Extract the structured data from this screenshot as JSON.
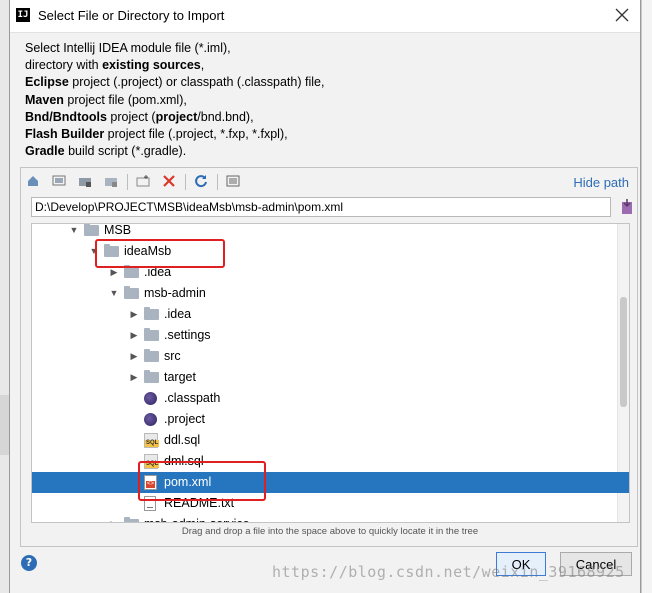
{
  "window": {
    "title": "Select File or Directory to Import",
    "app_icon_label": "IJ"
  },
  "description": {
    "lines": [
      [
        {
          "t": "Select Intellij IDEA module file (*.iml),",
          "b": false
        }
      ],
      [
        {
          "t": "directory with ",
          "b": false
        },
        {
          "t": "existing sources",
          "b": true
        },
        {
          "t": ",",
          "b": false
        }
      ],
      [
        {
          "t": "Eclipse",
          "b": true
        },
        {
          "t": " project (.project) or classpath (.classpath) file,",
          "b": false
        }
      ],
      [
        {
          "t": "Maven",
          "b": true
        },
        {
          "t": " project file (pom.xml),",
          "b": false
        }
      ],
      [
        {
          "t": "Bnd/Bndtools",
          "b": true
        },
        {
          "t": " project (",
          "b": false
        },
        {
          "t": "project",
          "b": true
        },
        {
          "t": "/bnd.bnd),",
          "b": false
        }
      ],
      [
        {
          "t": "Flash Builder",
          "b": true
        },
        {
          "t": " project file (.project, *.fxp, *.fxpl),",
          "b": false
        }
      ],
      [
        {
          "t": "Gradle",
          "b": true
        },
        {
          "t": " build script (*.gradle).",
          "b": false
        }
      ]
    ]
  },
  "toolbar": {
    "hide_path_label": "Hide path"
  },
  "path": {
    "value": "D:\\Develop\\PROJECT\\MSB\\ideaMsb\\msb-admin\\pom.xml"
  },
  "tree": {
    "rows": [
      {
        "label": "MSB",
        "arrow": "down",
        "icon": "folder",
        "level": 0
      },
      {
        "label": "ideaMsb",
        "arrow": "down",
        "icon": "folder",
        "level": 1
      },
      {
        "label": ".idea",
        "arrow": "right",
        "icon": "folder",
        "level": 2
      },
      {
        "label": "msb-admin",
        "arrow": "down",
        "icon": "folder",
        "level": 2
      },
      {
        "label": ".idea",
        "arrow": "right",
        "icon": "folder",
        "level": 3
      },
      {
        "label": ".settings",
        "arrow": "right",
        "icon": "folder",
        "level": 3
      },
      {
        "label": "src",
        "arrow": "right",
        "icon": "folder",
        "level": 3
      },
      {
        "label": "target",
        "arrow": "right",
        "icon": "folder",
        "level": 3
      },
      {
        "label": ".classpath",
        "arrow": "",
        "icon": "eclipse",
        "level": 3
      },
      {
        "label": ".project",
        "arrow": "",
        "icon": "eclipse",
        "level": 3
      },
      {
        "label": "ddl.sql",
        "arrow": "",
        "icon": "sql",
        "level": 3
      },
      {
        "label": "dml.sql",
        "arrow": "",
        "icon": "sql",
        "level": 3
      },
      {
        "label": "pom.xml",
        "arrow": "",
        "icon": "xml",
        "level": 3,
        "selected": true
      },
      {
        "label": "README.txt",
        "arrow": "",
        "icon": "txt",
        "level": 3
      },
      {
        "label": "msb-admin-service",
        "arrow": "right",
        "icon": "folder",
        "level": 2
      }
    ]
  },
  "hint": "Drag and drop a file into the space above to quickly locate it in the tree",
  "buttons": {
    "ok": "OK",
    "cancel": "Cancel",
    "help": "?"
  },
  "watermark": "https://blog.csdn.net/weixin_39168925",
  "colors": {
    "selection": "#2675bf",
    "link": "#2e6db5",
    "annotation": "#e02020"
  }
}
